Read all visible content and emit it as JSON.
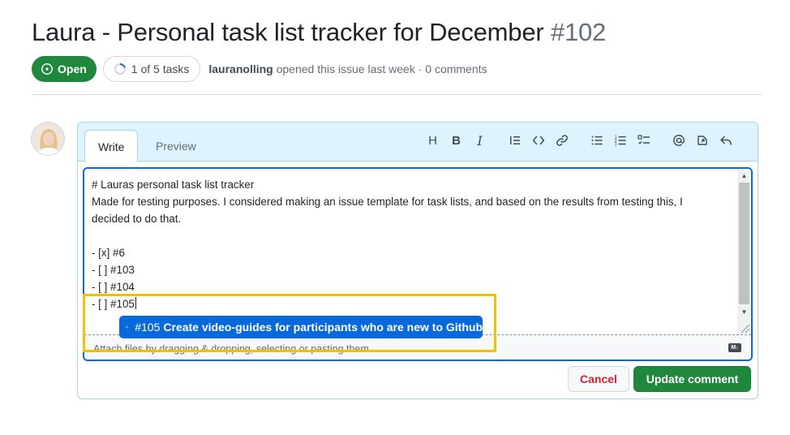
{
  "issue": {
    "title": "Laura - Personal task list tracker for December",
    "number": "#102",
    "state": "Open",
    "tasks": "1 of 5 tasks",
    "tasks_progress": 0.2,
    "author": "lauranolling",
    "byline_rest": "opened this issue last week · 0 comments"
  },
  "editor": {
    "tabs": [
      "Write",
      "Preview"
    ],
    "toolbar": [
      {
        "name": "heading-icon",
        "glyph": "H"
      },
      {
        "name": "bold-icon",
        "glyph": "B"
      },
      {
        "name": "italic-icon",
        "glyph": "I"
      },
      {
        "name": "quote-icon"
      },
      {
        "name": "code-icon"
      },
      {
        "name": "link-icon"
      },
      {
        "name": "unordered-list-icon"
      },
      {
        "name": "ordered-list-icon"
      },
      {
        "name": "task-list-icon"
      },
      {
        "name": "mention-icon"
      },
      {
        "name": "reference-icon"
      },
      {
        "name": "reply-icon"
      }
    ],
    "body_lines": [
      "# Lauras personal task list tracker",
      "Made for testing purposes. I considered making an issue template for task lists, and based on the results from testing this, I",
      "decided to do that.",
      "",
      "- [x] #6",
      "- [ ] #103",
      "- [ ] #104",
      "- [ ] #105"
    ],
    "attach_text": "Attach files by dragging & dropping, selecting or pasting them.",
    "markdown_badge": "M↓"
  },
  "suggestion": {
    "number": "#105",
    "title": "Create video-guides for participants who are new to Github"
  },
  "actions": {
    "cancel": "Cancel",
    "update": "Update comment"
  },
  "colors": {
    "open_green": "#1f883d",
    "accent_blue": "#0969da",
    "header_blue": "#ddf4ff",
    "highlight_yellow": "#f2c200",
    "cancel_red": "#cf222e"
  }
}
